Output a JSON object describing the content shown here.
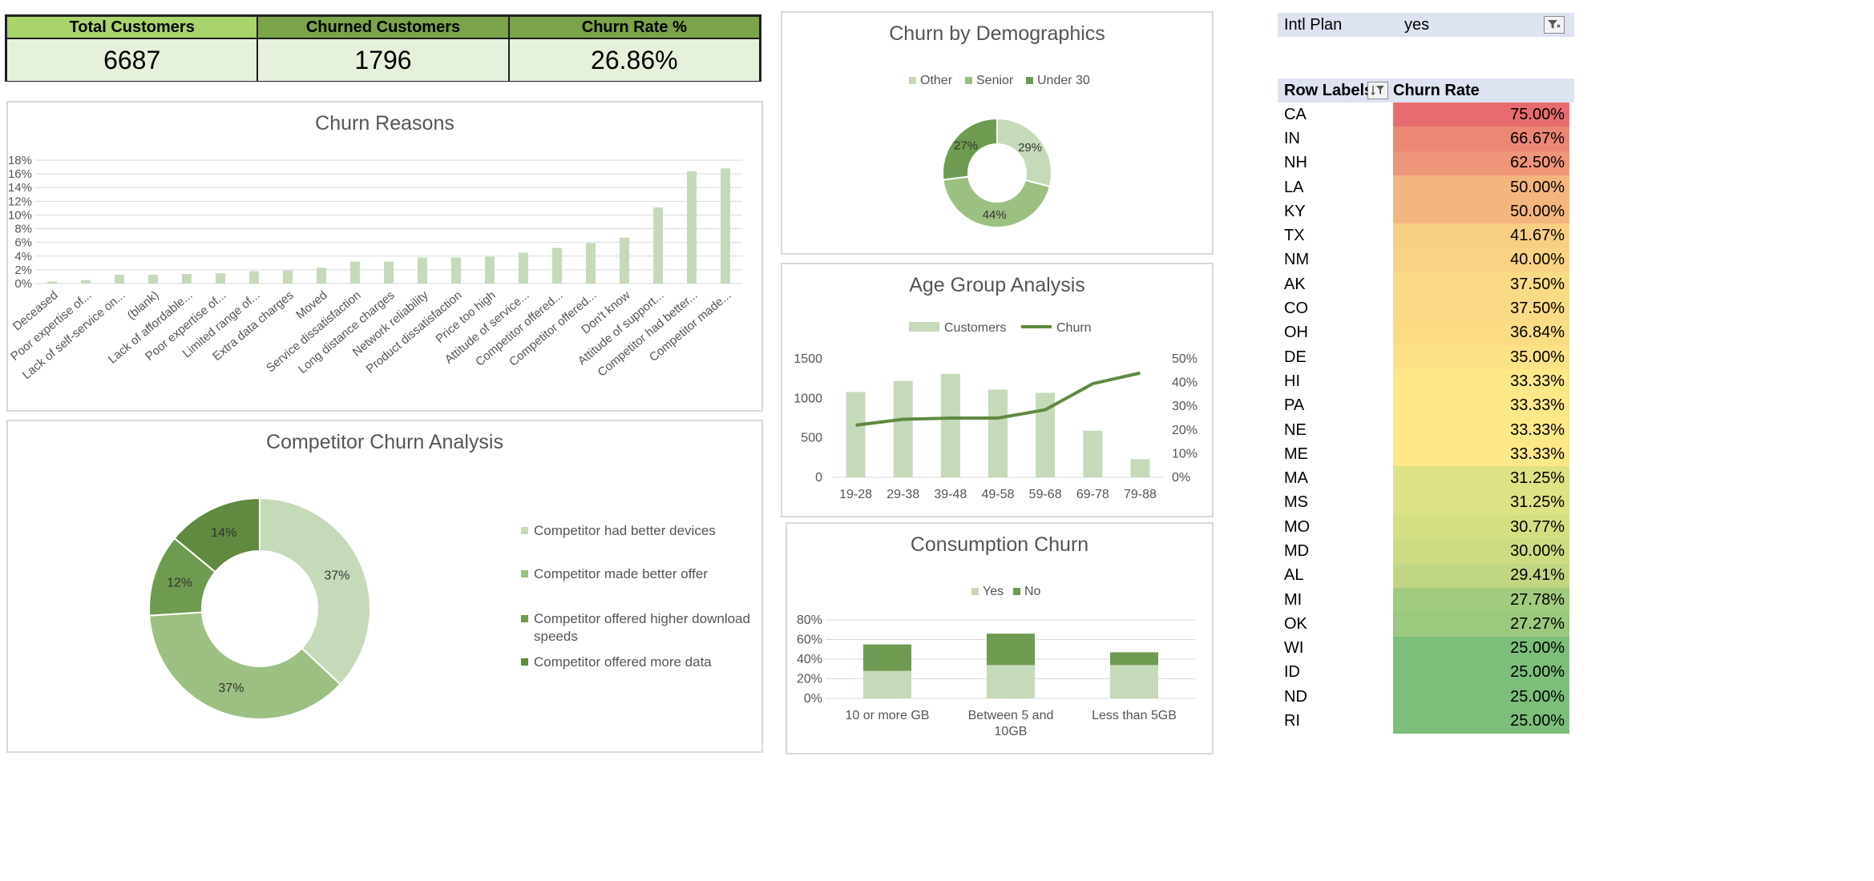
{
  "kpi": {
    "headers": [
      "Total Customers",
      "Churned Customers",
      "Churn Rate %"
    ],
    "values": [
      "6687",
      "1796",
      "26.86%"
    ],
    "header_colors": [
      "#a9d36b",
      "#7aa34a",
      "#7aa34a"
    ]
  },
  "colors": {
    "light": "#c5dab9",
    "mid": "#9cc081",
    "dark": "#6e9b50",
    "darker": "#5f8a40"
  },
  "charts": {
    "demographics": {
      "title": "Churn by Demographics",
      "legend": [
        "Other",
        "Senior",
        "Under 30"
      ],
      "values": [
        29,
        44,
        27
      ],
      "labels": [
        "29%",
        "44%",
        "27%"
      ]
    },
    "reasons": {
      "title": "Churn Reasons",
      "y_ticks": [
        "0%",
        "2%",
        "4%",
        "6%",
        "8%",
        "10%",
        "12%",
        "14%",
        "16%",
        "18%"
      ],
      "categories": [
        "Deceased",
        "Poor expertise of...",
        "Lack of self-service on...",
        "(blank)",
        "Lack of affordable...",
        "Poor expertise of...",
        "Limited range of...",
        "Extra data charges",
        "Moved",
        "Service dissatisfaction",
        "Long distance charges",
        "Network reliability",
        "Product dissatisfaction",
        "Price too high",
        "Attitude of service...",
        "Competitor offered...",
        "Competitor offered...",
        "Don't know",
        "Attitude of support...",
        "Competitor had better...",
        "Competitor made..."
      ],
      "values": [
        0.3,
        0.5,
        1.3,
        1.3,
        1.4,
        1.5,
        1.8,
        1.9,
        2.3,
        3.2,
        3.2,
        3.8,
        3.8,
        3.9,
        4.5,
        5.2,
        5.9,
        6.7,
        11.1,
        16.4,
        16.8
      ],
      "ylim": [
        0,
        18
      ]
    },
    "age": {
      "title": "Age Group Analysis",
      "legend": [
        "Customers",
        "Churn"
      ],
      "categories": [
        "19-28",
        "29-38",
        "39-48",
        "49-58",
        "59-68",
        "69-78",
        "79-88"
      ],
      "customers": [
        1080,
        1220,
        1310,
        1110,
        1070,
        590,
        230
      ],
      "churn": [
        22,
        24.5,
        25,
        25,
        28.5,
        39.5,
        44
      ],
      "y_left": [
        "0",
        "500",
        "1000",
        "1500"
      ],
      "y_right": [
        "0%",
        "10%",
        "20%",
        "30%",
        "40%",
        "50%"
      ]
    },
    "competitor": {
      "title": "Competitor Churn Analysis",
      "legend": [
        "Competitor had better devices",
        "Competitor made better offer",
        "Competitor offered higher download speeds",
        "Competitor offered more data"
      ],
      "values": [
        37,
        37,
        12,
        14
      ],
      "labels": [
        "37%",
        "37%",
        "12%",
        "14%"
      ]
    },
    "consumption": {
      "title": "Consumption Churn",
      "legend": [
        "Yes",
        "No"
      ],
      "categories": [
        "10 or more GB",
        "Between 5 and 10GB",
        "Less than 5GB"
      ],
      "yes": [
        28,
        34,
        34
      ],
      "no": [
        27,
        32,
        13
      ],
      "y_ticks": [
        "0%",
        "20%",
        "40%",
        "60%",
        "80%"
      ],
      "ylim": [
        0,
        80
      ]
    }
  },
  "pivot": {
    "filter_label": "Intl Plan",
    "filter_value": "yes",
    "col1": "Row Labels",
    "col2": "Churn Rate",
    "rows": [
      {
        "state": "CA",
        "rate": "75.00%",
        "color": "#e86c6f"
      },
      {
        "state": "IN",
        "rate": "66.67%",
        "color": "#ed8775"
      },
      {
        "state": "NH",
        "rate": "62.50%",
        "color": "#ef9579"
      },
      {
        "state": "LA",
        "rate": "50.00%",
        "color": "#f4b67f"
      },
      {
        "state": "KY",
        "rate": "50.00%",
        "color": "#f4b67f"
      },
      {
        "state": "TX",
        "rate": "41.67%",
        "color": "#f8cf82"
      },
      {
        "state": "NM",
        "rate": "40.00%",
        "color": "#f9d383"
      },
      {
        "state": "AK",
        "rate": "37.50%",
        "color": "#fada84"
      },
      {
        "state": "CO",
        "rate": "37.50%",
        "color": "#fada84"
      },
      {
        "state": "OH",
        "rate": "36.84%",
        "color": "#fbdc85"
      },
      {
        "state": "DE",
        "rate": "35.00%",
        "color": "#fce186"
      },
      {
        "state": "HI",
        "rate": "33.33%",
        "color": "#fde888"
      },
      {
        "state": "PA",
        "rate": "33.33%",
        "color": "#fde888"
      },
      {
        "state": "NE",
        "rate": "33.33%",
        "color": "#fde888"
      },
      {
        "state": "ME",
        "rate": "33.33%",
        "color": "#fde888"
      },
      {
        "state": "MA",
        "rate": "31.25%",
        "color": "#dde284"
      },
      {
        "state": "MS",
        "rate": "31.25%",
        "color": "#dde284"
      },
      {
        "state": "MO",
        "rate": "30.77%",
        "color": "#d4df83"
      },
      {
        "state": "MD",
        "rate": "30.00%",
        "color": "#cddb82"
      },
      {
        "state": "AL",
        "rate": "29.41%",
        "color": "#c1d681"
      },
      {
        "state": "MI",
        "rate": "27.78%",
        "color": "#a1cb7e"
      },
      {
        "state": "OK",
        "rate": "27.27%",
        "color": "#9bc97d"
      },
      {
        "state": "WI",
        "rate": "25.00%",
        "color": "#7cbf7b"
      },
      {
        "state": "ID",
        "rate": "25.00%",
        "color": "#7cbf7b"
      },
      {
        "state": "ND",
        "rate": "25.00%",
        "color": "#7cbf7b"
      },
      {
        "state": "RI",
        "rate": "25.00%",
        "color": "#7cbf7b"
      }
    ]
  }
}
